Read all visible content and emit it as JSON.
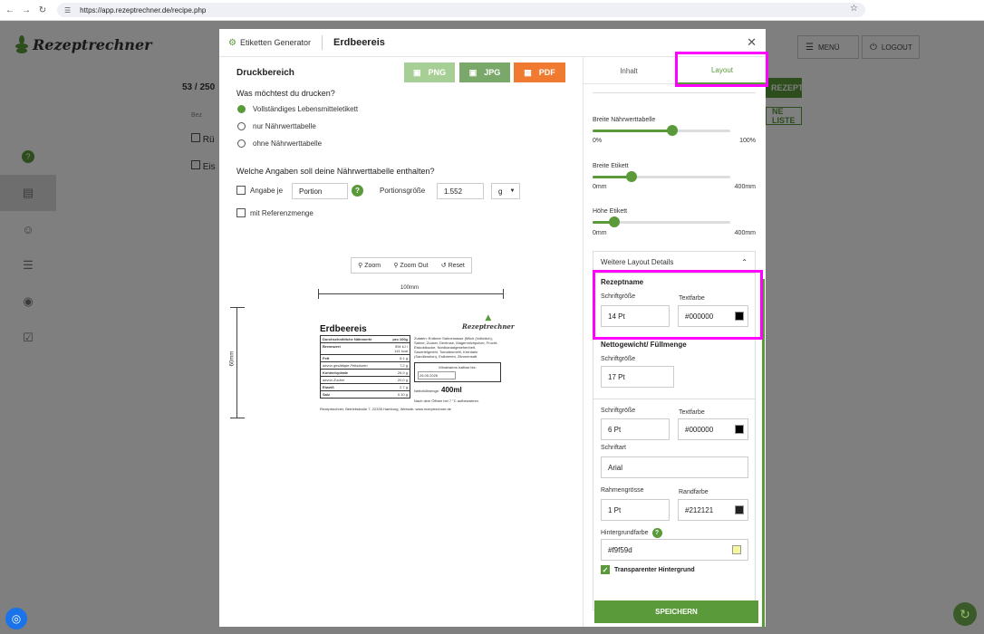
{
  "browser": {
    "url": "https://app.rezeptrechner.de/recipe.php"
  },
  "app": {
    "logo_text": "Rezeptrechner",
    "menu_label": "MENÜ",
    "logout_label": "LOGOUT",
    "count_text": "53 / 250",
    "bg_button_1": "REZEPT",
    "bg_button_2": "NE LISTE",
    "bg_row_1": "Rü",
    "bg_row_2": "Eis",
    "bg_col": "Bez"
  },
  "modal": {
    "generator_label": "Etiketten Generator",
    "recipe_title": "Erdbeereis",
    "print_area_title": "Druckbereich",
    "export": {
      "png": "PNG",
      "jpg": "JPG",
      "pdf": "PDF"
    },
    "question_print": "Was möchtest du drucken?",
    "print_options": [
      {
        "label": "Vollständiges Lebensmitteletikett",
        "selected": true
      },
      {
        "label": "nur Nährwerttabelle",
        "selected": false
      },
      {
        "label": "ohne Nährwerttabelle",
        "selected": false
      }
    ],
    "question_table": "Welche Angaben soll deine Nährwerttabelle enthalten?",
    "per_label": "Angabe je",
    "per_value": "Portion",
    "portion_size_label": "Portionsgröße",
    "portion_size_value": "1.552",
    "unit_value": "g",
    "reference_label": "mit Referenzmenge",
    "zoom": {
      "in": "Zoom",
      "out": "Zoom Out",
      "reset": "Reset"
    },
    "preview": {
      "width_label": "100mm",
      "height_label": "60mm",
      "name": "Erdbeereis",
      "logo": "Rezeptrechner",
      "table_header": "Durchschnittliche Nährwerte",
      "per_header": "pro 100g",
      "rows": [
        {
          "label": "Brennwert",
          "value": "594 kJ / 141 kcal"
        },
        {
          "label": "Fett",
          "value": "6,1 g"
        },
        {
          "label": "davon gesättigte Fettsäuren",
          "value": "7,2 g"
        },
        {
          "label": "Kohlenhydrate",
          "value": "26,9 g"
        },
        {
          "label": "davon Zucker",
          "value": "20,0 g"
        },
        {
          "label": "Eiweiß",
          "value": "2,7 g"
        },
        {
          "label": "Salz",
          "value": "0,10 g"
        }
      ],
      "ingredients": "Zutaten: Erdbeer Sahnemasse (Milch (Vollmilch), Sahne, Zucker, Dextrose, Magermilchpulver, Frucht-Eiskoktkucke, Nordkanadgesehenheit, Sauerteigmehl, Tomatenmehl, Kerntarin (Sandlenelon), Erdbeeren, Zitronensaft",
      "mhd_label": "Mindestens haltbar bis:",
      "mhd_value": "26.05.2026",
      "net_label": "Nettofüllmenge:",
      "net_value": "400ml",
      "storage": "Nach dem Öffnen bei 7 °C aufbewahren.",
      "footer": "Rezeptrechner, Betriebstraße 7, 22335 Hamburg, Website: www.rezeptrechner.de"
    },
    "tabs": {
      "content": "Inhalt",
      "layout": "Layout"
    },
    "sliders": [
      {
        "label": "Breite Nährwerttabelle",
        "min": "0%",
        "max": "100%",
        "fraction": 0.58
      },
      {
        "label": "Breite Etikett",
        "min": "0mm",
        "max": "400mm",
        "fraction": 0.28
      },
      {
        "label": "Höhe Etikett",
        "min": "0mm",
        "max": "400mm",
        "fraction": 0.16
      }
    ],
    "details_title": "Weitere Layout Details",
    "rezeptname": {
      "title": "Rezeptname",
      "size_label": "Schriftgröße",
      "size": "14 Pt",
      "color_label": "Textfarbe",
      "color": "#000000"
    },
    "netto": {
      "title": "Nettogewicht/ Füllmenge",
      "size_label": "Schriftgröße",
      "size": "17 Pt"
    },
    "general": {
      "size_label": "Schriftgröße",
      "size": "6 Pt",
      "color_label": "Textfarbe",
      "color": "#000000",
      "font_label": "Schriftart",
      "font": "Arial",
      "border_label": "Rahmengrösse",
      "border": "1 Pt",
      "border_color_label": "Randfarbe",
      "border_color": "#212121",
      "bg_label": "Hintergrundfarbe",
      "bg": "#f9f59d",
      "transparent_label": "Transparenter Hintergrund"
    },
    "save_label": "SPEICHERN"
  },
  "colors": {
    "accent": "#5a9a3a",
    "highlight": "#ff00ff",
    "png": "#a7cf95",
    "jpg": "#7aa86a",
    "pdf": "#f07a30"
  }
}
